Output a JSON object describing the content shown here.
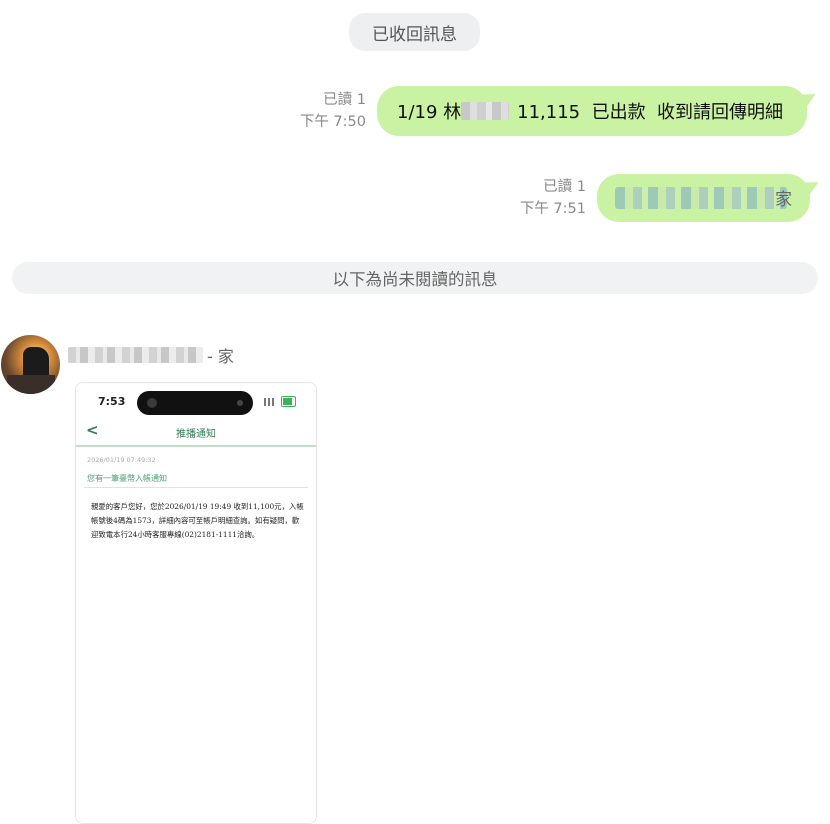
{
  "system": {
    "recalled_notice": "已收回訊息",
    "unread_divider": "以下為尚未閱讀的訊息"
  },
  "messages": [
    {
      "read_status": "已讀 1",
      "time": "下午 7:50",
      "text_prefix": "1/19 林",
      "text_suffix": "11,115  已出款  收到請回傳明細",
      "redacted": true
    },
    {
      "read_status": "已讀 1",
      "time": "下午 7:51",
      "text_end": "家",
      "redacted": true
    }
  ],
  "incoming": {
    "sender_name_end": "- 家",
    "screenshot": {
      "status_time": "7:53",
      "nav_back": "<",
      "nav_title": "推播通知",
      "timestamp": "2026/01/19 07:49:32",
      "subtitle": "您有一筆臺幣入帳通知",
      "body": "親愛的客戶您好，您於2026/01/19 19:49 收到11,100元，入帳帳號後4碼為1573，詳細內容可至帳戶明細查詢。如有疑問，歡迎致電本行24小時客服專線(02)2181-1111洽詢。"
    }
  },
  "colors": {
    "bubble_green": "#c9f2a3",
    "accent_green": "#2e7d52"
  }
}
